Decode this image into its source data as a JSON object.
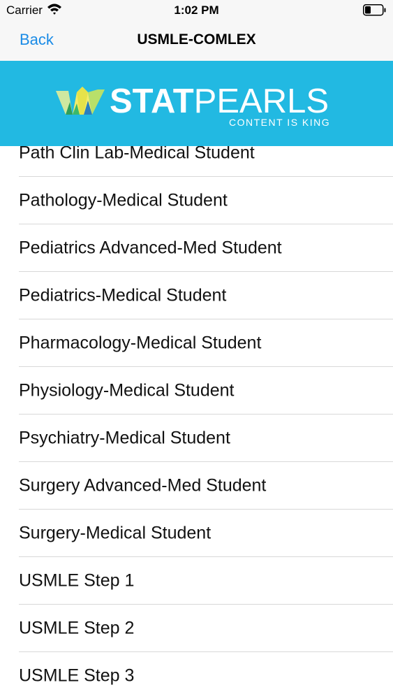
{
  "status_bar": {
    "carrier": "Carrier",
    "time": "1:02 PM"
  },
  "nav": {
    "back_label": "Back",
    "title": "USMLE-COMLEX",
    "accent_color": "#1a8be6"
  },
  "banner": {
    "brand_stat": "STAT",
    "brand_pearls": "PEARLS",
    "tagline": "CONTENT IS KING",
    "background_color": "#22b9e2"
  },
  "list": {
    "items": [
      {
        "label": "Path Clin Lab-Medical Student"
      },
      {
        "label": "Pathology-Medical Student"
      },
      {
        "label": "Pediatrics Advanced-Med Student"
      },
      {
        "label": "Pediatrics-Medical Student"
      },
      {
        "label": "Pharmacology-Medical Student"
      },
      {
        "label": "Physiology-Medical Student"
      },
      {
        "label": "Psychiatry-Medical Student"
      },
      {
        "label": "Surgery Advanced-Med Student"
      },
      {
        "label": "Surgery-Medical Student"
      },
      {
        "label": "USMLE Step 1"
      },
      {
        "label": "USMLE Step 2"
      },
      {
        "label": "USMLE Step 3"
      }
    ]
  }
}
